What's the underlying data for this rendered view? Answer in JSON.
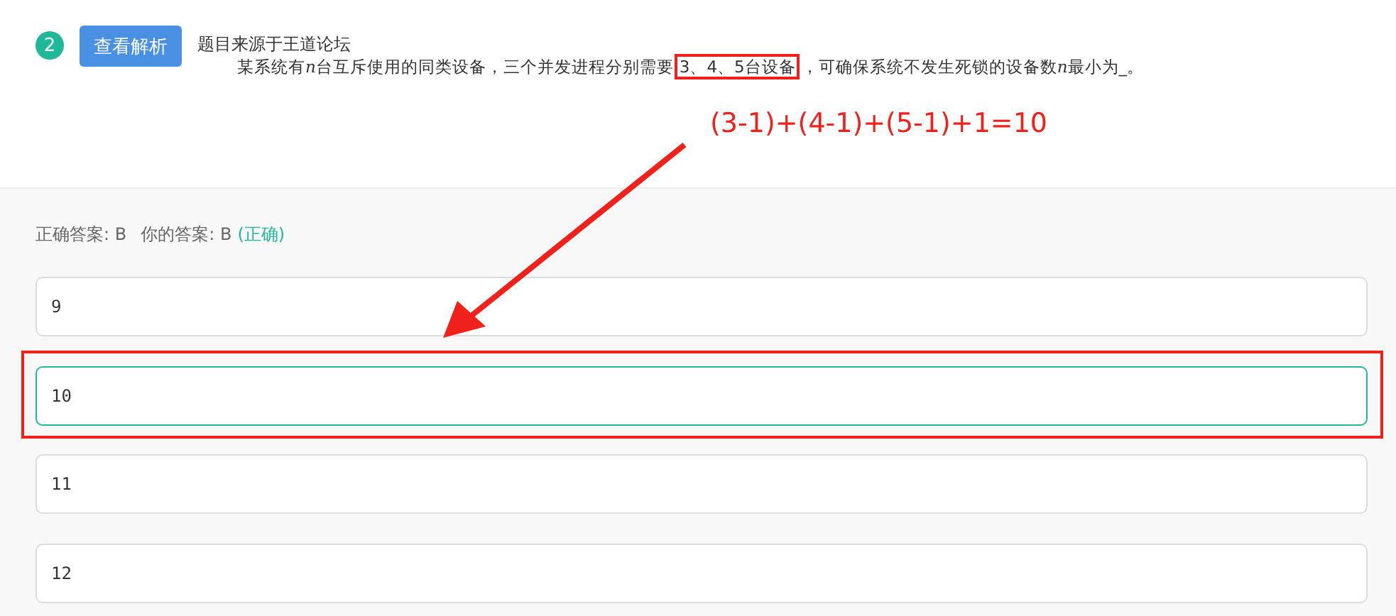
{
  "question": {
    "number": "2",
    "button": "查看解析",
    "source": "题目来源于王道论坛",
    "parts": [
      {
        "text": "某系统有",
        "highlighted": false,
        "italic": false
      },
      {
        "text": "n",
        "highlighted": false,
        "italic": true
      },
      {
        "text": "台互斥使用的同类设备，三个并发进程分别需要",
        "highlighted": false,
        "italic": false
      },
      {
        "text": "3、4、5台设备",
        "highlighted": true,
        "italic": false
      },
      {
        "text": "，可确保系统不发生死锁的设备数",
        "highlighted": false,
        "italic": false
      },
      {
        "text": "n",
        "highlighted": false,
        "italic": true
      },
      {
        "text": "最小为_。",
        "highlighted": false,
        "italic": false
      }
    ]
  },
  "annotation": {
    "formula": "(3-1)+(4-1)+(5-1)+1=10"
  },
  "result": {
    "correct_label": "正确答案: B",
    "your_label": "你的答案: B",
    "verdict": "(正确)"
  },
  "options": [
    {
      "text": "9",
      "selected": false,
      "annotated": false
    },
    {
      "text": "10",
      "selected": true,
      "annotated": true
    },
    {
      "text": "11",
      "selected": false,
      "annotated": false
    },
    {
      "text": "12",
      "selected": false,
      "annotated": false
    }
  ]
}
